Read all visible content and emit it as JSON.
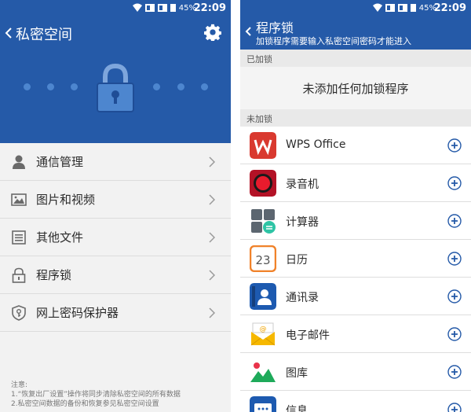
{
  "status": {
    "battery": "45%",
    "time": "22:09"
  },
  "left": {
    "title": "私密空间",
    "menu": [
      {
        "label": "通信管理",
        "icon": "contact-icon"
      },
      {
        "label": "图片和视频",
        "icon": "image-icon"
      },
      {
        "label": "其他文件",
        "icon": "file-icon"
      },
      {
        "label": "程序锁",
        "icon": "lock-icon"
      },
      {
        "label": "网上密码保护器",
        "icon": "key-shield-icon"
      }
    ],
    "notes": {
      "heading": "注意:",
      "line1": "1.“恢复出厂设置”操作将同步清除私密空间的所有数据",
      "line2": "2.私密空间数据的备份和恢复参见私密空间设置"
    }
  },
  "right": {
    "title": "程序锁",
    "subtitle": "加锁程序需要输入私密空间密码才能进入",
    "locked_header": "已加锁",
    "locked_empty": "未添加任何加锁程序",
    "unlocked_header": "未加锁",
    "apps": [
      {
        "label": "WPS Office",
        "icon": "wps-icon"
      },
      {
        "label": "录音机",
        "icon": "recorder-icon"
      },
      {
        "label": "计算器",
        "icon": "calculator-icon"
      },
      {
        "label": "日历",
        "icon": "calendar-icon",
        "icon_text": "23"
      },
      {
        "label": "通讯录",
        "icon": "contacts-book-icon"
      },
      {
        "label": "电子邮件",
        "icon": "email-icon"
      },
      {
        "label": "图库",
        "icon": "gallery-icon"
      },
      {
        "label": "信息",
        "icon": "messages-icon"
      }
    ]
  },
  "colors": {
    "header": "#255aa8",
    "add": "#255aa8"
  }
}
